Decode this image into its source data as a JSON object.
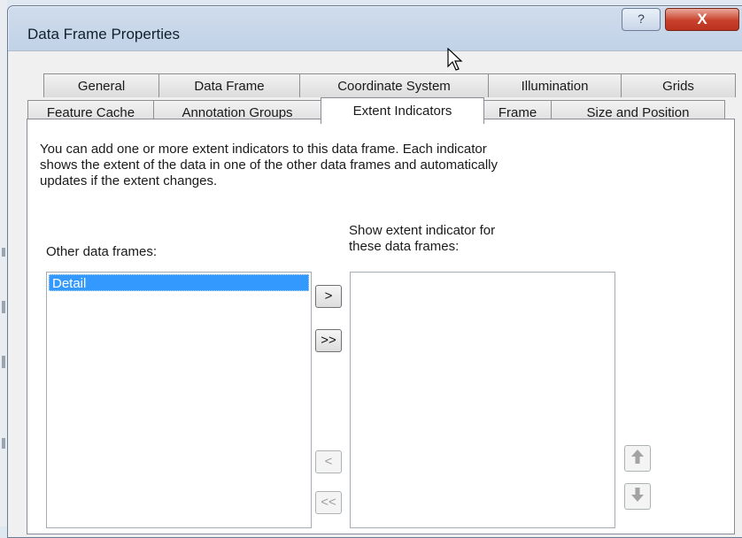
{
  "window": {
    "title": "Data Frame Properties",
    "help_label": "?",
    "close_label": "X"
  },
  "tabs": {
    "row1": [
      "General",
      "Data Frame",
      "Coordinate System",
      "Illumination",
      "Grids"
    ],
    "row2": [
      "Feature Cache",
      "Annotation Groups",
      "Extent Indicators",
      "Frame",
      "Size and Position"
    ],
    "active": "Extent Indicators"
  },
  "panel": {
    "description_line1": "You can add one or more extent indicators to this data frame.  Each indicator",
    "description_line2": "shows the extent of the data in one of the other data frames and automatically",
    "description_line3": "updates if the extent changes.",
    "other_frames_label": "Other data frames:",
    "other_frames": [
      "Detail"
    ],
    "show_label_line1": "Show extent indicator for",
    "show_label_line2": "these data frames:",
    "buttons": {
      "add": ">",
      "add_all": ">>",
      "remove": "<",
      "remove_all": "<<"
    }
  },
  "icons": {
    "move_up": "arrow-up-icon",
    "move_down": "arrow-down-icon"
  }
}
